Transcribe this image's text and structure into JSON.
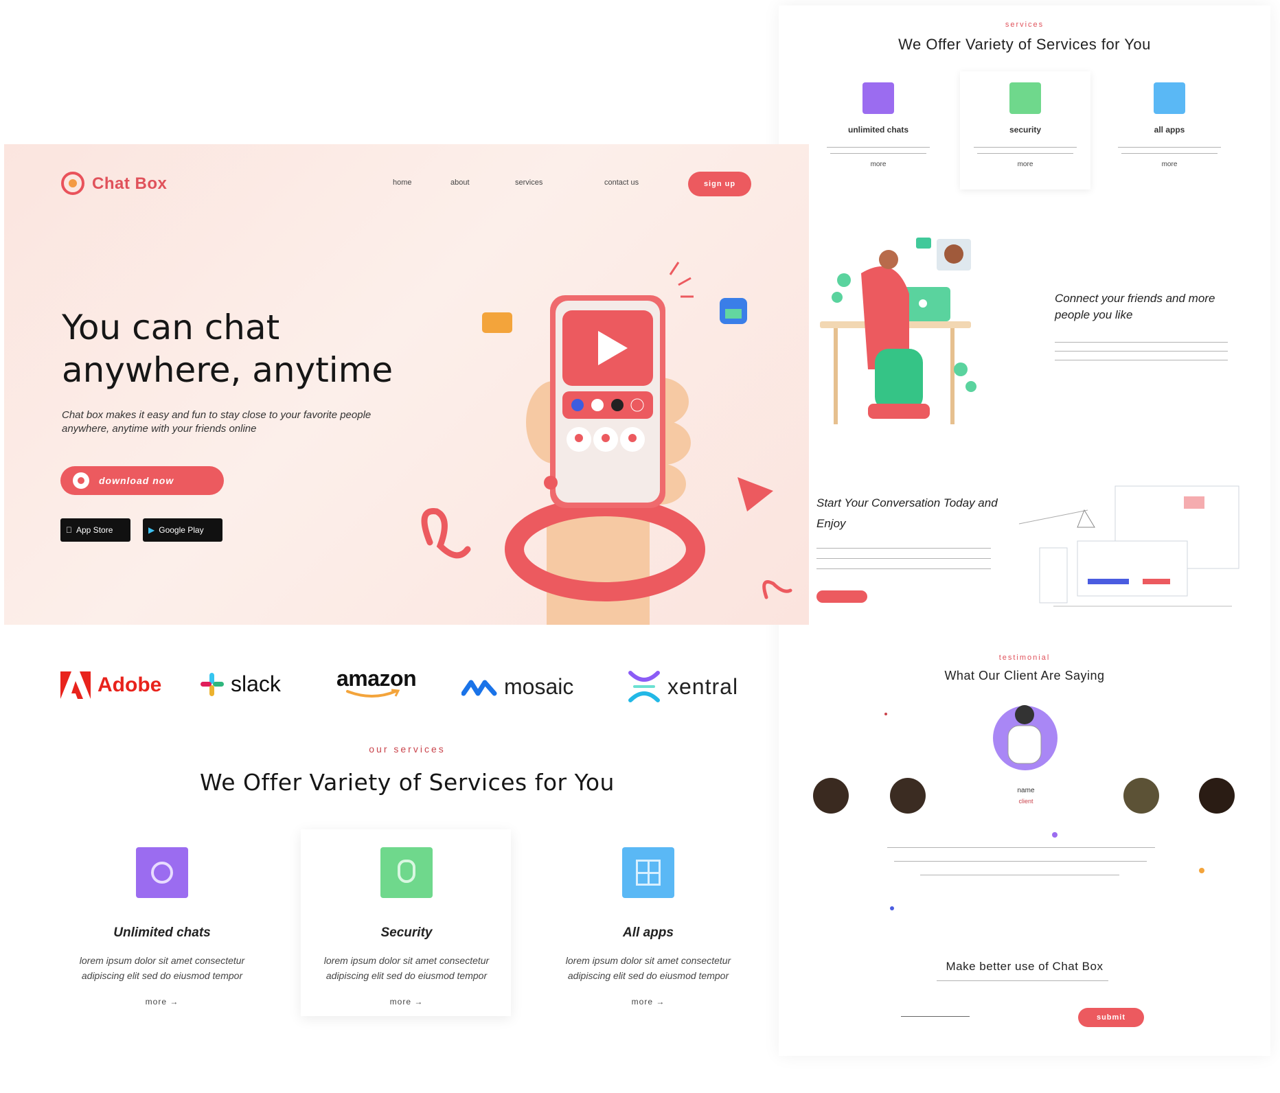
{
  "back": {
    "services_eyebrow": "services",
    "services_title": "We Offer Variety of Services for You",
    "services": [
      {
        "name": "unlimited chats",
        "more": "more",
        "color": "#9b6cf0"
      },
      {
        "name": "security",
        "more": "more",
        "color": "#6fd88c"
      },
      {
        "name": "all apps",
        "more": "more",
        "color": "#5ab8f5"
      }
    ],
    "connect_title": "Connect your friends and more people you like",
    "start_title": "Start Your Conversation Today and Enjoy",
    "testimonial_eyebrow": "testimonial",
    "testimonial_title": "What Our Client Are Saying",
    "client_name": "name",
    "client_role": "client",
    "cta_title": "Make better use of Chat Box",
    "cta_button": "submit"
  },
  "header": {
    "logo_text": "Chat Box",
    "nav": [
      "home",
      "about",
      "services",
      "contact us"
    ],
    "nav_button": "sign up"
  },
  "hero": {
    "title_line1": "You can chat",
    "title_line2": "anywhere, anytime",
    "desc_line1": "Chat box makes it easy and fun to stay close to your favorite people",
    "desc_line2": "anywhere, anytime with your friends online",
    "cta": "download now",
    "app_store": "App Store",
    "google_play": "Google Play"
  },
  "brands": [
    {
      "name": "Adobe",
      "icon": "adobe-icon",
      "color": "#e8231c"
    },
    {
      "name": "slack",
      "icon": "slack-icon",
      "color": "#111111"
    },
    {
      "name": "amazon",
      "icon": "amazon-smile-icon",
      "color": "#111111"
    },
    {
      "name": "mosaic",
      "icon": "mosaic-icon",
      "color": "#111111"
    },
    {
      "name": "xentral",
      "icon": "xentral-icon",
      "color": "#111111"
    }
  ],
  "services": {
    "eyebrow": "our services",
    "title": "We Offer Variety of Services for You",
    "cards": [
      {
        "name": "Unlimited chats",
        "desc1": "lorem ipsum dolor sit amet consectetur",
        "desc2": "adipiscing elit sed do eiusmod tempor",
        "more": "more",
        "color": "#9b6cf0"
      },
      {
        "name": "Security",
        "desc1": "lorem ipsum dolor sit amet consectetur",
        "desc2": "adipiscing elit sed do eiusmod tempor",
        "more": "more",
        "color": "#6fd88c"
      },
      {
        "name": "All apps",
        "desc1": "lorem ipsum dolor sit amet consectetur",
        "desc2": "adipiscing elit sed do eiusmod tempor",
        "more": "more",
        "color": "#5ab8f5"
      }
    ]
  },
  "colors": {
    "accent": "#ec5a5f",
    "hero_bg": "#fbe8e2"
  }
}
